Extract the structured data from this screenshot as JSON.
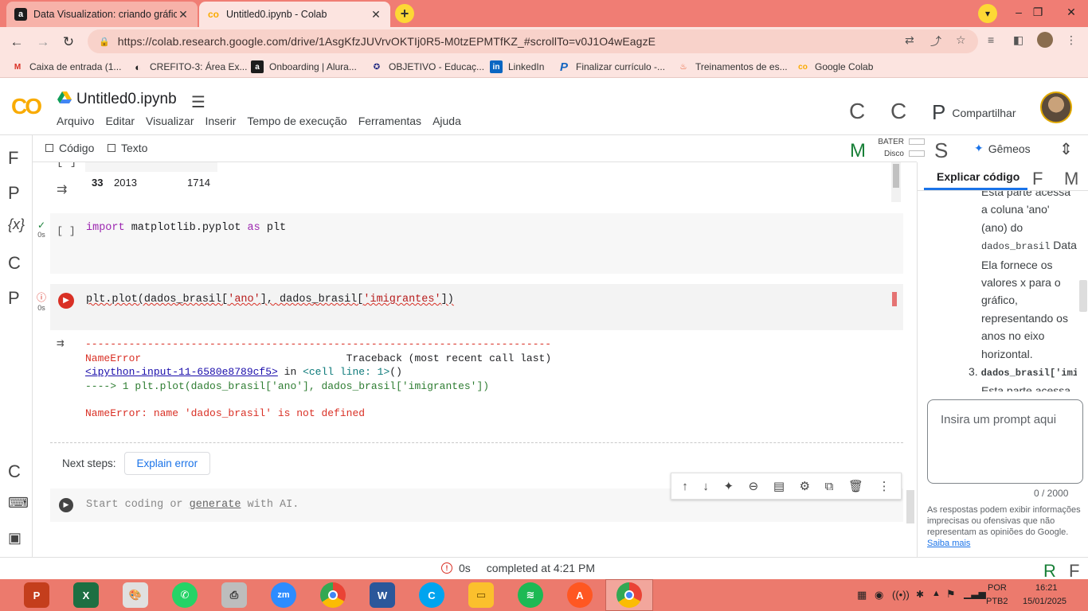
{
  "browser": {
    "tabs": [
      {
        "title": "Data Visualization: criando gráfic",
        "favicon": "alura-icon",
        "active": false
      },
      {
        "title": "Untitled0.ipynb - Colab",
        "favicon": "colab-icon",
        "active": true
      }
    ],
    "url": "https://colab.research.google.com/drive/1AsgKfzJUVrvOKTIj0R5-M0tzEPMTfKZ_#scrollTo=v0J1O4wEagzE",
    "bookmarks": [
      {
        "label": "Caixa de entrada (1...",
        "icon": "gmail-icon"
      },
      {
        "label": "CREFITO-3: Área Ex...",
        "icon": "crefito-icon"
      },
      {
        "label": "Onboarding | Alura...",
        "icon": "alura-icon"
      },
      {
        "label": "OBJETIVO - Educaç...",
        "icon": "objetivo-icon"
      },
      {
        "label": "LinkedIn",
        "icon": "linkedin-icon"
      },
      {
        "label": "Finalizar currículo -...",
        "icon": "p-icon"
      },
      {
        "label": "Treinamentos de es...",
        "icon": "fire-icon"
      },
      {
        "label": "Google Colab",
        "icon": "colab-icon"
      }
    ]
  },
  "colab": {
    "notebook_title": "Untitled0.ipynb",
    "menu": [
      "Arquivo",
      "Editar",
      "Visualizar",
      "Inserir",
      "Tempo de execução",
      "Ferramentas",
      "Ajuda"
    ],
    "share_label": "Compartilhar",
    "toolbar": {
      "code_label": "Código",
      "text_label": "Texto",
      "ram_label": "BATER",
      "disk_label": "Disco",
      "gemini_label": "Gêmeos"
    }
  },
  "notebook": {
    "top_output_row": {
      "index": "33",
      "year": "2013",
      "value": "1714"
    },
    "cell1": {
      "status_time": "0s",
      "bracket": "[ ]",
      "code_kw": "import",
      "code_mod": " matplotlib.pyplot ",
      "code_as": "as",
      "code_alias": " plt"
    },
    "cell2": {
      "status_time": "0s",
      "code_pre": "plt.plot(dados_brasil[",
      "code_s1": "'ano'",
      "code_mid": "], dados_brasil[",
      "code_s2": "'imigrantes'",
      "code_post": "])"
    },
    "error": {
      "dashes": "---------------------------------------------------------------------------",
      "type": "NameError",
      "traceback_header": "Traceback (most recent call last)",
      "link": "<ipython-input-11-6580e8789cf5>",
      "in_word": " in ",
      "cell_line": "<cell line: 1>",
      "cell_paren": "()",
      "arrow_line": "----> 1 plt.plot(dados_brasil['ano'], dados_brasil['imigrantes'])",
      "message": "NameError: name 'dados_brasil' is not defined"
    },
    "next_steps_label": "Next steps:",
    "explain_error_label": "Explain error",
    "cell3": {
      "placeholder_pre": "Start coding or ",
      "placeholder_link": "generate",
      "placeholder_post": " with AI."
    }
  },
  "gemini_panel": {
    "tab_label": "Explicar código",
    "lines": [
      "Esta parte acessa",
      "a coluna 'ano'",
      "(ano) do"
    ],
    "code_word": "dados_brasil",
    "after_code": " Data",
    "lines2": [
      "Ela fornece os",
      "valores x para o",
      "gráfico,",
      "representando os",
      "anos no eixo",
      "horizontal."
    ],
    "item3_num": "3.",
    "item3_code": "dados_brasil['imi",
    "item3_next": "Esta parte acessa",
    "prompt_placeholder": "Insira um prompt aqui",
    "counter": "0 / 2000",
    "disclaimer": "As respostas podem exibir informações imprecisas ou ofensivas que não representam as opiniões do Google.",
    "learn_more": "Saiba mais"
  },
  "statusbar": {
    "time": "0s",
    "completed": "completed at 4:21 PM"
  },
  "taskbar": {
    "lang1": "POR",
    "lang2": "PTB2",
    "clock_time": "16:21",
    "clock_date": "15/01/2025"
  },
  "colors": {
    "tabstrip": "#f07d74",
    "toolbar": "#fce4e0",
    "error_red": "#d93025",
    "link_blue": "#1a73e8",
    "taskbar": "#ec7a6d"
  }
}
